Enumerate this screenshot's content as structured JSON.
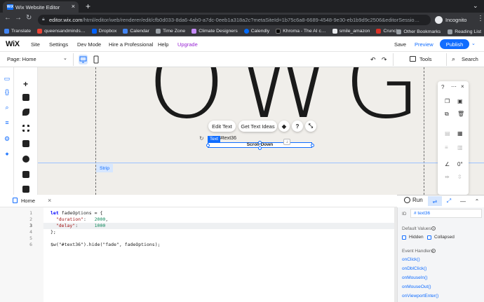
{
  "browser": {
    "tab_title": "Wix Website Editor",
    "tab_favicon": "WiX",
    "url_host": "editor.wix.com",
    "url_path": "/html/editor/web/renderer/edit/cfb0d033-8da6-4ab0-a7dc-0eeb1a318a2c?metaSiteId=1b75c6a8-6689-4548-9e30-eb1b9d9c2506&editorSessio…",
    "profile_label": "Incognito",
    "bookmarks": [
      {
        "label": "Translate",
        "color": "#4285f4"
      },
      {
        "label": "queensandminds…",
        "color": "#ea4335"
      },
      {
        "label": "Dropbox",
        "color": "#0061ff"
      },
      {
        "label": "Calendar",
        "color": "#4285f4"
      },
      {
        "label": "Time Zone",
        "color": "#9aa0a6"
      },
      {
        "label": "Climate Designers",
        "color": "#c58af9"
      },
      {
        "label": "Calendly",
        "color": "#006bff"
      },
      {
        "label": "Khroma - The AI c…",
        "color": "#000000"
      },
      {
        "label": "smile_amazon",
        "color": "#e8eaed"
      },
      {
        "label": "Crunch",
        "color": "#d93025"
      }
    ],
    "other_bookmarks": "Other Bookmarks",
    "reading_list": "Reading List"
  },
  "wix_top": {
    "logo": "WiX",
    "menu": [
      "Site",
      "Settings",
      "Dev Mode",
      "Hire a Professional",
      "Help",
      "Upgrade"
    ],
    "save": "Save",
    "preview": "Preview",
    "publish": "Publish"
  },
  "wix_sub": {
    "page_selector": "Page: Home",
    "tools": "Tools",
    "search": "Search"
  },
  "canvas": {
    "heading": "OWG",
    "strip_label": "Strip",
    "edit_text": "Edit Text",
    "get_text_ideas": "Get Text Ideas",
    "selected_tag": "Text",
    "selected_id": "#text36",
    "selected_text": "Scroll Down"
  },
  "code_panel": {
    "tab": "Home",
    "run": "Run",
    "lines": [
      {
        "n": "1"
      },
      {
        "n": "2"
      },
      {
        "n": "3"
      },
      {
        "n": "4"
      },
      {
        "n": "5"
      },
      {
        "n": "6"
      }
    ],
    "code_line1_kw": "let",
    "code_line1_rest": " fadeOptions = {",
    "code_line2_key": "\"duration\"",
    "code_line2_val": "2000",
    "code_line3_key": "\"delay\"",
    "code_line3_val": "1000",
    "code_line4": "};",
    "code_line6": "$w(\"#text36\").hide(\"fade\", fadeOptions);"
  },
  "properties": {
    "id_label": "ID",
    "id_value": "# text36",
    "default_values": "Default Values",
    "hidden": "Hidden",
    "collapsed": "Collapsed",
    "event_handlers": "Event Handlers",
    "events": [
      "onClick()",
      "onDblClick()",
      "onMouseIn()",
      "onMouseOut()",
      "onViewportEnter()"
    ]
  },
  "colors": {
    "accent": "#116dff",
    "upgrade": "#9a27d5",
    "canvas_bg": "#f0eeea"
  }
}
